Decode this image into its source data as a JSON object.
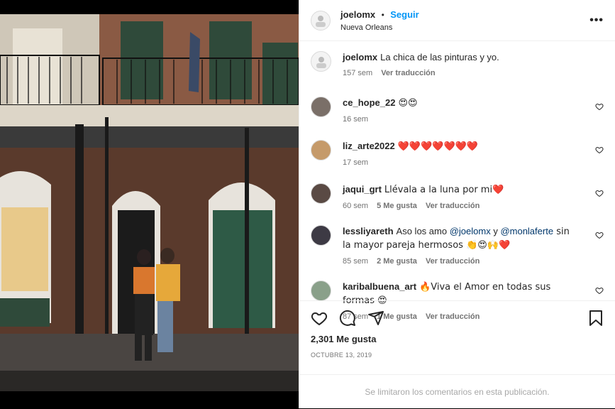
{
  "header": {
    "username": "joelomx",
    "separator": "•",
    "follow_label": "Seguir",
    "location": "Nueva Orleans",
    "more": "•••"
  },
  "caption": {
    "username": "joelomx",
    "text": "La chica de las pinturas y yo.",
    "time": "157 sem",
    "translate": "Ver traducción"
  },
  "comments": [
    {
      "username": "ce_hope_22",
      "text": "😍😍",
      "time": "16 sem",
      "likes": "",
      "translate": ""
    },
    {
      "username": "liz_arte2022",
      "text": "❤️❤️❤️❤️❤️❤️❤️",
      "time": "17 sem",
      "likes": "",
      "translate": ""
    },
    {
      "username": "jaqui_grt",
      "text": "Llévala a la luna por mi❤️",
      "time": "60 sem",
      "likes": "5 Me gusta",
      "translate": "Ver traducción"
    },
    {
      "username": "lessliyareth",
      "text_a": "Aso los amo ",
      "mention1": "@joelomx",
      "text_b": " y ",
      "mention2": "@monlaferte",
      "text_c": " sin la mayor pareja hermosos 👏😍🙌❤️",
      "time": "85 sem",
      "likes": "2 Me gusta",
      "translate": "Ver traducción"
    },
    {
      "username": "karibalbuena_art",
      "text": "🔥Viva el Amor en todas sus formas 😍",
      "time": "87 sem",
      "likes": "1 Me gusta",
      "translate": "Ver traducción"
    }
  ],
  "footer": {
    "likes": "2,301 Me gusta",
    "date": "OCTUBRE 13, 2019",
    "comments_closed": "Se limitaron los comentarios en esta publicación."
  },
  "colors": {
    "accent": "#0095f6",
    "mention": "#00376b",
    "heart": "#ed4956"
  }
}
